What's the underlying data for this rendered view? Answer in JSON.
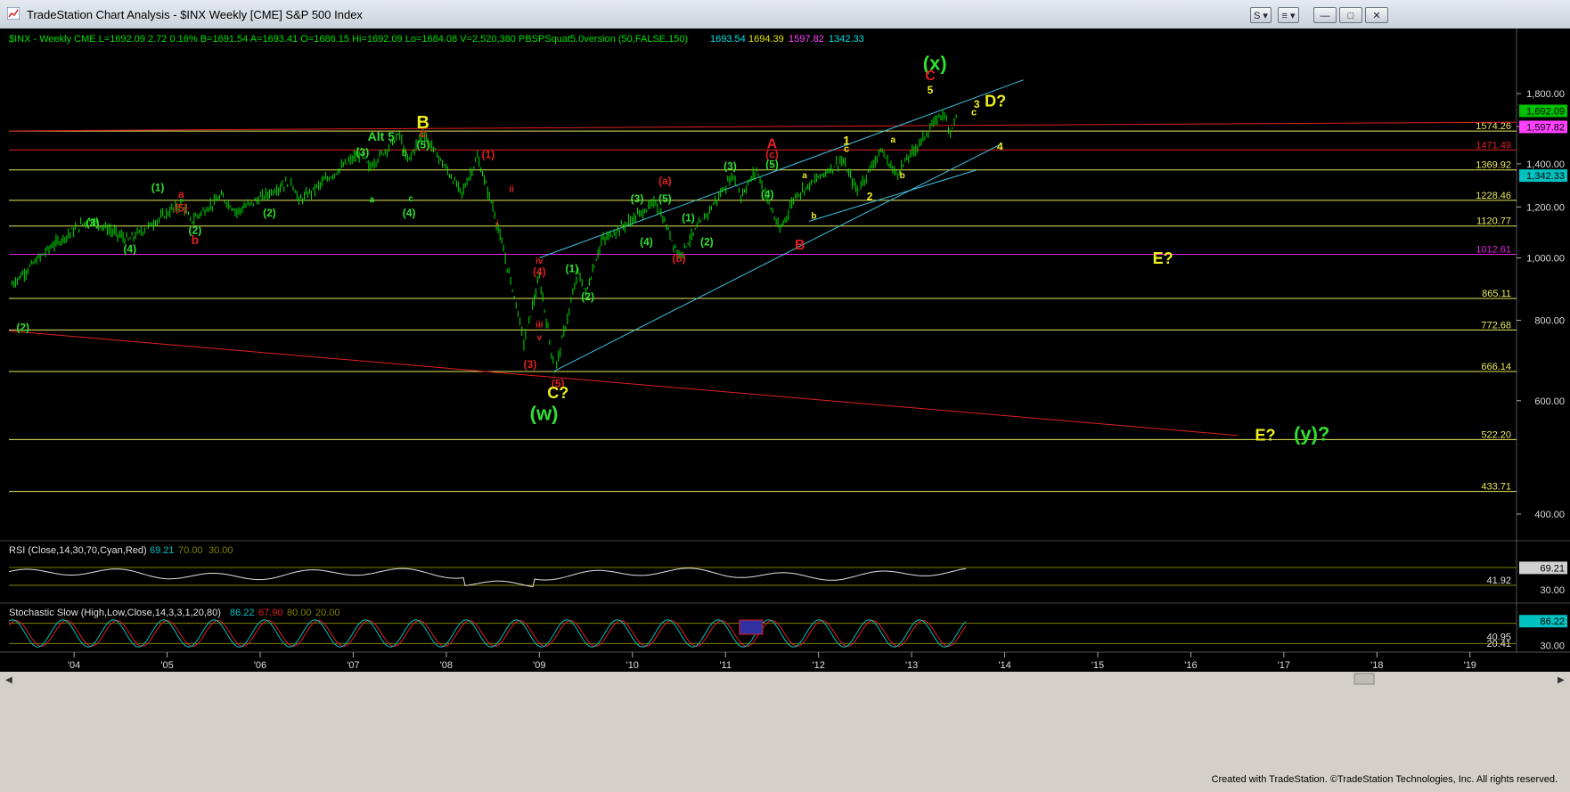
{
  "window": {
    "title": "TradeStation Chart Analysis - $INX Weekly [CME] S&P 500 Index",
    "controls": {
      "s_label": "S",
      "list_label": "≡",
      "min_label": "—",
      "max_label": "□",
      "close_label": "✕"
    }
  },
  "header": {
    "symbol_info": "$INX - Weekly  CME  L=1692.09  2.72  0.16%  B=1691.54  A=1693.41  O=1686.15  Hi=1692.09  Lo=1684.08  V=2,520,380  PBSPSquat5.0version (50,FALSE,150)",
    "ind_values": [
      {
        "text": "1693.54",
        "color": "#00e0e0"
      },
      {
        "text": "1694.39",
        "color": "#e0e000"
      },
      {
        "text": "1597.82",
        "color": "#ff40ff"
      },
      {
        "text": "1342.33",
        "color": "#00e0e0"
      }
    ]
  },
  "colors": {
    "bars": "#00e000",
    "yellow_line": "#e8e860",
    "red_line": "#e02020",
    "magenta_line": "#e020e0",
    "channel": "#40c0e0",
    "green_label": "#30e030",
    "yellow_label": "#f0f020",
    "red_label": "#e02020"
  },
  "chart_data": [
    {
      "type": "line",
      "title": "$INX Weekly S&P 500 Index",
      "xlabel": "",
      "ylabel": "",
      "x_ticks": [
        "'04",
        "'05",
        "'06",
        "'07",
        "'08",
        "'09",
        "'10",
        "'11",
        "'12",
        "'13",
        "'14",
        "'15",
        "'16",
        "'17",
        "'18",
        "'19"
      ],
      "y_ticks": [
        "1,800.00",
        "1,600.00",
        "1,400.00",
        "1,200.00",
        "1,000.00",
        "800.00",
        "600.00",
        "400.00"
      ],
      "ylim": [
        400,
        2000
      ],
      "y_scale": "log",
      "horizontal_levels": [
        {
          "value": 1574.26,
          "label": "1574.26",
          "color": "#e8e860"
        },
        {
          "value": 1471.49,
          "label": "1471.49",
          "color": "#e02020"
        },
        {
          "value": 1369.92,
          "label": "1369.92",
          "color": "#e8e860"
        },
        {
          "value": 1228.46,
          "label": "1228.46",
          "color": "#e8e860"
        },
        {
          "value": 1120.77,
          "label": "1120.77",
          "color": "#e8e860"
        },
        {
          "value": 1012.61,
          "label": "1012.61",
          "color": "#e020e0"
        },
        {
          "value": 865.11,
          "label": "865.11",
          "color": "#e8e860"
        },
        {
          "value": 772.68,
          "label": "772.68",
          "color": "#e8e860"
        },
        {
          "value": 666.14,
          "label": "666.14",
          "color": "#e8e860"
        },
        {
          "value": 522.2,
          "label": "522.20",
          "color": "#e8e860"
        },
        {
          "value": 433.71,
          "label": "433.71",
          "color": "#e8e860"
        }
      ],
      "price_badges": [
        {
          "value": 1692.09,
          "label": "1,692.09",
          "bg": "#00c000",
          "fg": "#000"
        },
        {
          "value": 1597.82,
          "label": "1,597.82",
          "bg": "#ff40ff",
          "fg": "#000"
        },
        {
          "value": 1342.33,
          "label": "1,342.33",
          "bg": "#00c0c0",
          "fg": "#000"
        }
      ],
      "series": [
        {
          "values": [
            [
              "2003-05",
              910
            ],
            [
              "2003-10",
              1040
            ],
            [
              "2004-03",
              1150
            ],
            [
              "2004-08",
              1065
            ],
            [
              "2005-03",
              1220
            ],
            [
              "2005-04",
              1140
            ],
            [
              "2005-08",
              1245
            ],
            [
              "2005-10",
              1180
            ],
            [
              "2006-05",
              1320
            ],
            [
              "2006-06",
              1225
            ],
            [
              "2007-02",
              1460
            ],
            [
              "2007-03",
              1380
            ],
            [
              "2007-07",
              1555
            ],
            [
              "2007-08",
              1410
            ],
            [
              "2007-10",
              1565
            ],
            [
              "2008-03",
              1260
            ],
            [
              "2008-05",
              1430
            ],
            [
              "2008-07",
              1200
            ],
            [
              "2008-10",
              850
            ],
            [
              "2008-11",
              740
            ],
            [
              "2009-01",
              930
            ],
            [
              "2009-03",
              666
            ],
            [
              "2009-06",
              950
            ],
            [
              "2009-07",
              880
            ],
            [
              "2009-09",
              1060
            ],
            [
              "2010-04",
              1220
            ],
            [
              "2010-07",
              1010
            ],
            [
              "2011-02",
              1345
            ],
            [
              "2011-03",
              1250
            ],
            [
              "2011-05",
              1370
            ],
            [
              "2011-08",
              1100
            ],
            [
              "2011-10",
              1250
            ],
            [
              "2012-04",
              1420
            ],
            [
              "2012-06",
              1270
            ],
            [
              "2012-09",
              1470
            ],
            [
              "2012-11",
              1350
            ],
            [
              "2013-05",
              1685
            ],
            [
              "2013-06",
              1575
            ],
            [
              "2013-07",
              1692
            ]
          ]
        }
      ],
      "wave_labels": [
        "(x)",
        "C",
        "5",
        "3",
        "c",
        "D?",
        "B",
        "c",
        "Alt 5",
        "(5)",
        "b",
        "(3)",
        "a",
        "c",
        "(4)",
        "(2)",
        "ii",
        "(1)",
        "i",
        "a",
        "(5)",
        "b",
        "(1)",
        "(3)",
        "(2)",
        "(4)",
        "(2)",
        "iv",
        "(4)",
        "iii",
        "v",
        "(3)",
        "(5)",
        "C?",
        "(w)",
        "(1)",
        "(2)",
        "(3)",
        "(a)",
        "(5)",
        "(4)",
        "(b)",
        "(1)",
        "(2)",
        "(3)",
        "A",
        "(c)",
        "(5)",
        "(4)",
        "B",
        "1",
        "c",
        "a",
        "b",
        "a",
        "b",
        "2",
        "4",
        "E?",
        "E?",
        "(y)?"
      ]
    },
    {
      "type": "line",
      "title": "RSI (Close,14,30,70,Cyan,Red)",
      "legend_values": [
        "69.21",
        "70.00",
        "30.00"
      ],
      "y_ticks": [
        "30.00"
      ],
      "badge": "69.21",
      "level_labels": [
        "41.92"
      ],
      "ylim": [
        0,
        100
      ],
      "last": 69.21
    },
    {
      "type": "line",
      "title": "Stochastic Slow (High,Low,Close,14,3,3,1,20,80)",
      "legend_values": [
        "86.22",
        "67.90",
        "80.00",
        "20.00"
      ],
      "y_ticks": [
        "30.00"
      ],
      "badge": "86.22",
      "level_labels": [
        "40.95",
        "20.41"
      ],
      "ylim": [
        0,
        100
      ],
      "k_last": 86.22,
      "d_last": 67.9
    }
  ],
  "footer": {
    "credit": "Created with TradeStation. ©TradeStation Technologies, Inc. All rights reserved."
  }
}
